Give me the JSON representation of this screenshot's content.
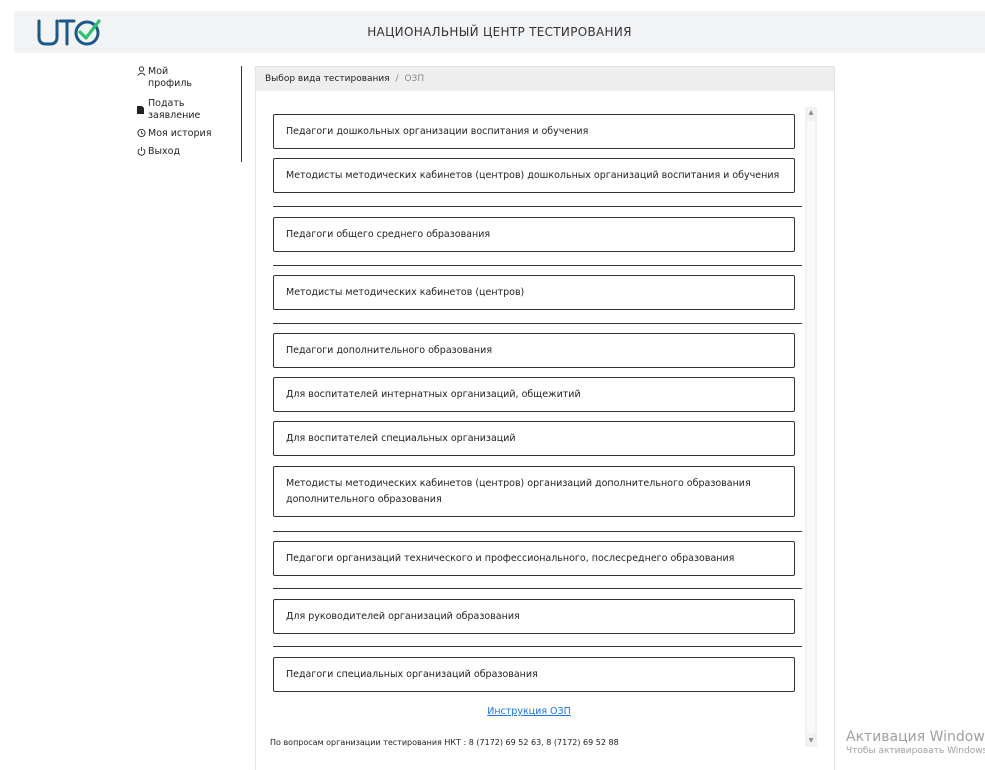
{
  "header": {
    "logo_colors": {
      "primary": "#1a5a8a",
      "check": "#2ec36b"
    },
    "title": "НАЦИОНАЛЬНЫЙ ЦЕНТР ТЕСТИРОВАНИЯ"
  },
  "sidebar": {
    "items": [
      {
        "icon": "user-icon",
        "label": "Мой профиль"
      },
      {
        "icon": "document-icon",
        "label": "Подать заявление"
      },
      {
        "icon": "history-icon",
        "label": "Моя история"
      },
      {
        "icon": "power-icon",
        "label": "Выход"
      }
    ]
  },
  "breadcrumb": {
    "parent": "Выбор вида тестирования",
    "separator": "/",
    "current": "ОЗП"
  },
  "options": [
    "Педагоги дошкольных организации воспитания и обучения",
    "Методисты методических кабинетов (центров) дошкольных организаций воспитания и обучения",
    "Педагоги общего среднего образования",
    "Методисты методических кабинетов (центров)",
    "Педагоги дополнительного образования",
    "Для воспитателей интернатных организаций, общежитий",
    "Для воспитателей специальных организаций",
    "Методисты методических кабинетов (центров) организаций дополнительного образования дополнительного образования",
    "Педагоги организаций технического и профессионального, послесреднего образования",
    "Для руководителей организаций образования",
    "Педагоги специальных организаций образования"
  ],
  "instruction_link": "Инструкция ОЗП",
  "contact": "По вопросам организации тестирования НКТ : 8 (7172) 69 52 63, 8 (7172) 69 52 88",
  "watermark": {
    "line1": "Активация Windows",
    "line2": "Чтобы активировать Windows"
  }
}
